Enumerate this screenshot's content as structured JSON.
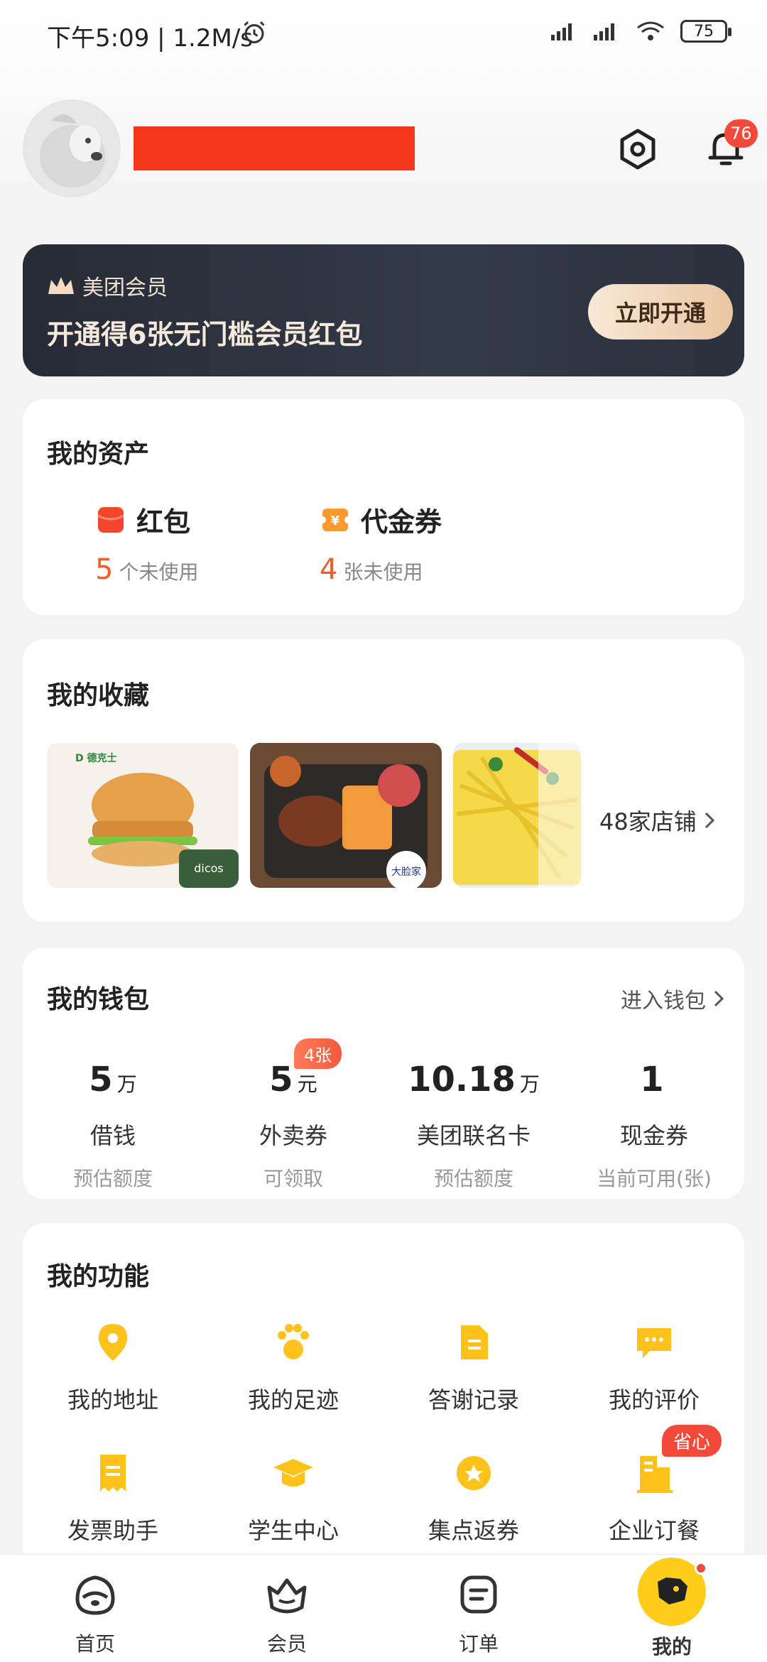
{
  "status_bar": {
    "time_speed": "下午5:09 | 1.2M/s",
    "battery": "75"
  },
  "header": {
    "notification_count": "76"
  },
  "member": {
    "brand": "美团会员",
    "title": "开通得6张无门槛会员红包",
    "button": "立即开通"
  },
  "assets": {
    "title": "我的资产",
    "items": [
      {
        "label": "红包",
        "count": "5",
        "unit": "个未使用",
        "icon": "red-packet-icon"
      },
      {
        "label": "代金券",
        "count": "4",
        "unit": "张未使用",
        "icon": "voucher-icon"
      }
    ]
  },
  "favorites": {
    "title": "我的收藏",
    "store_count": "48家店铺"
  },
  "wallet": {
    "title": "我的钱包",
    "link": "进入钱包",
    "badge": "4张",
    "items": [
      {
        "value": "5",
        "unit": "万",
        "name": "借钱",
        "sub": "预估额度"
      },
      {
        "value": "5",
        "unit": "元",
        "name": "外卖券",
        "sub": "可领取"
      },
      {
        "value": "10.18",
        "unit": "万",
        "name": "美团联名卡",
        "sub": "预估额度"
      },
      {
        "value": "1",
        "unit": "",
        "name": "现金券",
        "sub": "当前可用(张)"
      }
    ]
  },
  "functions": {
    "title": "我的功能",
    "save_badge": "省心",
    "items": [
      {
        "label": "我的地址",
        "icon": "location-pin-icon"
      },
      {
        "label": "我的足迹",
        "icon": "paw-icon"
      },
      {
        "label": "答谢记录",
        "icon": "document-icon"
      },
      {
        "label": "我的评价",
        "icon": "chat-bubble-icon"
      },
      {
        "label": "发票助手",
        "icon": "invoice-icon"
      },
      {
        "label": "学生中心",
        "icon": "graduation-cap-icon"
      },
      {
        "label": "集点返券",
        "icon": "star-coin-icon"
      },
      {
        "label": "企业订餐",
        "icon": "building-icon"
      }
    ]
  },
  "nav": {
    "items": [
      {
        "label": "首页"
      },
      {
        "label": "会员"
      },
      {
        "label": "订单"
      },
      {
        "label": "我的"
      }
    ]
  },
  "colors": {
    "accent_yellow": "#ffcc1a",
    "accent_orange": "#f45d2a",
    "badge_red": "#f2493b",
    "banner_dark": "#2c323e"
  }
}
